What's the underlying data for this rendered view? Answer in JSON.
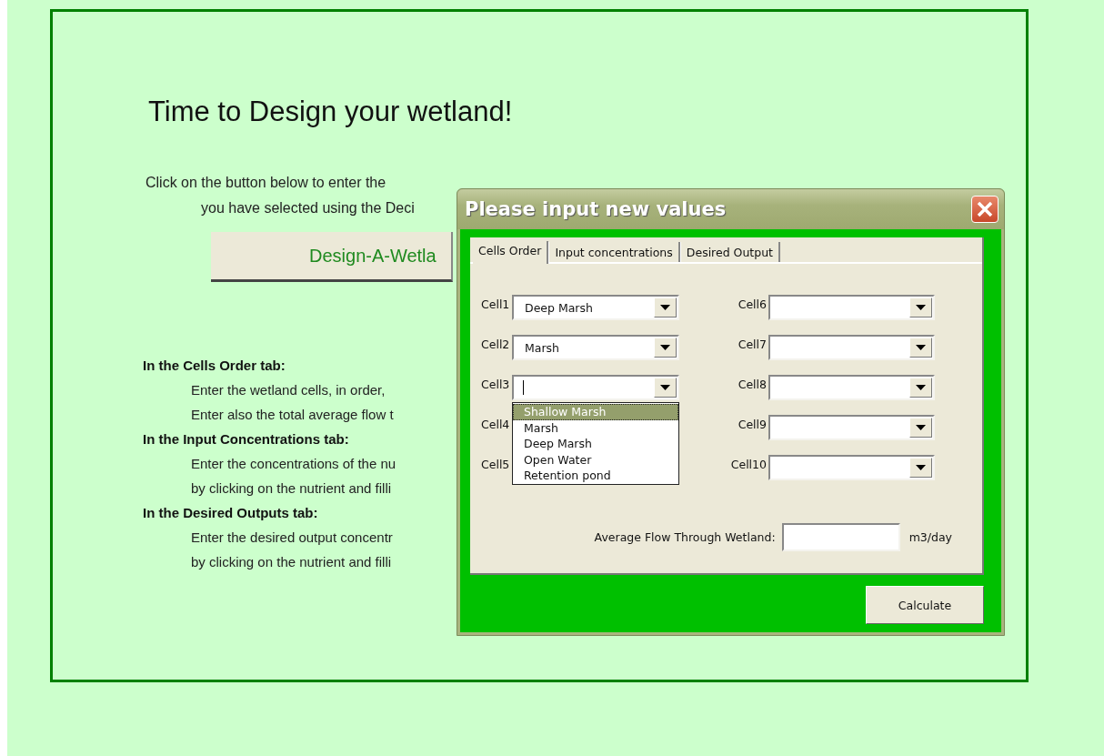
{
  "sheet": {
    "title": "Time to Design your wetland!",
    "intro_lines": [
      "Click on the button below to enter the",
      "you have selected using the Deci"
    ],
    "design_button": "Design-A-Wetla",
    "instructions": [
      {
        "heading": "In the Cells Order tab:",
        "lines": [
          "Enter the wetland cells, in order,",
          "Enter also the total average flow t"
        ]
      },
      {
        "heading": "In the Input Concentrations tab:",
        "lines": [
          "Enter the concentrations of the nu",
          "by clicking on the nutrient and filli"
        ]
      },
      {
        "heading": "In the Desired Outputs tab:",
        "lines": [
          "Enter the desired output concentr",
          "by clicking on the nutrient and filli"
        ]
      }
    ]
  },
  "dialog": {
    "title": "Please input new values",
    "tabs": [
      {
        "label": "Cells Order",
        "selected": true
      },
      {
        "label": "Input concentrations",
        "selected": false
      },
      {
        "label": "Desired Output",
        "selected": false
      }
    ],
    "cells_left": [
      {
        "label": "Cell1",
        "kind": "combo",
        "value": "Deep Marsh",
        "focused": false
      },
      {
        "label": "Cell2",
        "kind": "combo",
        "value": "Marsh",
        "focused": false
      },
      {
        "label": "Cell3",
        "kind": "combo",
        "focused": true,
        "options": [
          {
            "label": "Shallow Marsh",
            "selected": true
          },
          {
            "label": "Marsh",
            "selected": false
          },
          {
            "label": "Deep Marsh",
            "selected": false
          },
          {
            "label": "Open Water",
            "selected": false
          },
          {
            "label": "Retention pond",
            "selected": false
          }
        ]
      },
      {
        "label": "Cell4",
        "kind": "covered"
      },
      {
        "label": "Cell5",
        "kind": "covered"
      }
    ],
    "cells_right": [
      {
        "label": "Cell6",
        "kind": "combo",
        "focused": false
      },
      {
        "label": "Cell7",
        "kind": "combo",
        "focused": false
      },
      {
        "label": "Cell8",
        "kind": "combo",
        "focused": false
      },
      {
        "label": "Cell9",
        "kind": "combo",
        "focused": false
      },
      {
        "label": "Cell10",
        "kind": "combo",
        "focused": false
      }
    ],
    "flow": {
      "label": "Average Flow Through Wetland:",
      "unit": "m3/day"
    },
    "calculate_button": "Calculate"
  }
}
